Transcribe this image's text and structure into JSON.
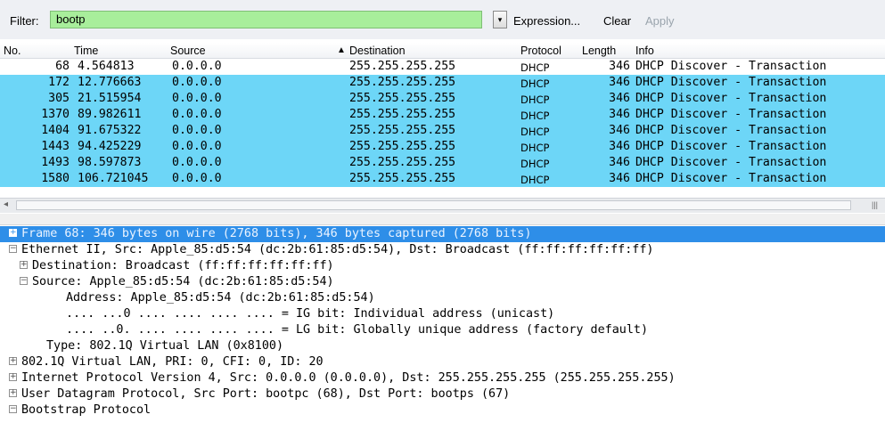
{
  "filter": {
    "label": "Filter:",
    "value": "bootp",
    "dropdown_icon": "▾",
    "expression_label": "Expression...",
    "clear_label": "Clear",
    "apply_label": "Apply"
  },
  "packet_list": {
    "columns": {
      "no": "No.",
      "time": "Time",
      "source": "Source",
      "sort_icon": "▲",
      "destination": "Destination",
      "protocol": "Protocol",
      "length": "Length",
      "info": "Info"
    },
    "rows": [
      {
        "no": "68",
        "time": "4.564813",
        "source": "0.0.0.0",
        "destination": "255.255.255.255",
        "protocol": "DHCP",
        "length": "346",
        "info": "DHCP Discover - Transaction"
      },
      {
        "no": "172",
        "time": "12.776663",
        "source": "0.0.0.0",
        "destination": "255.255.255.255",
        "protocol": "DHCP",
        "length": "346",
        "info": "DHCP Discover - Transaction"
      },
      {
        "no": "305",
        "time": "21.515954",
        "source": "0.0.0.0",
        "destination": "255.255.255.255",
        "protocol": "DHCP",
        "length": "346",
        "info": "DHCP Discover - Transaction"
      },
      {
        "no": "1370",
        "time": "89.982611",
        "source": "0.0.0.0",
        "destination": "255.255.255.255",
        "protocol": "DHCP",
        "length": "346",
        "info": "DHCP Discover - Transaction"
      },
      {
        "no": "1404",
        "time": "91.675322",
        "source": "0.0.0.0",
        "destination": "255.255.255.255",
        "protocol": "DHCP",
        "length": "346",
        "info": "DHCP Discover - Transaction"
      },
      {
        "no": "1443",
        "time": "94.425229",
        "source": "0.0.0.0",
        "destination": "255.255.255.255",
        "protocol": "DHCP",
        "length": "346",
        "info": "DHCP Discover - Transaction"
      },
      {
        "no": "1493",
        "time": "98.597873",
        "source": "0.0.0.0",
        "destination": "255.255.255.255",
        "protocol": "DHCP",
        "length": "346",
        "info": "DHCP Discover - Transaction"
      },
      {
        "no": "1580",
        "time": "106.721045",
        "source": "0.0.0.0",
        "destination": "255.255.255.255",
        "protocol": "DHCP",
        "length": "346",
        "info": "DHCP Discover - Transaction"
      }
    ],
    "scroll_left_icon": "◂",
    "scroll_grip_icon": "|||"
  },
  "details": {
    "rows": [
      {
        "expander": "+",
        "text": "Frame 68: 346 bytes on wire (2768 bits), 346 bytes captured (2768 bits)"
      },
      {
        "expander": "−",
        "text": "Ethernet II, Src: Apple_85:d5:54 (dc:2b:61:85:d5:54), Dst: Broadcast (ff:ff:ff:ff:ff:ff)"
      },
      {
        "expander": "+",
        "text": "Destination: Broadcast (ff:ff:ff:ff:ff:ff)"
      },
      {
        "expander": "−",
        "text": "Source: Apple_85:d5:54 (dc:2b:61:85:d5:54)"
      },
      {
        "expander": "",
        "text": "Address: Apple_85:d5:54 (dc:2b:61:85:d5:54)"
      },
      {
        "expander": "",
        "text": ".... ...0 .... .... .... .... = IG bit: Individual address (unicast)"
      },
      {
        "expander": "",
        "text": ".... ..0. .... .... .... .... = LG bit: Globally unique address (factory default)"
      },
      {
        "expander": "",
        "text": "Type: 802.1Q Virtual LAN (0x8100)"
      },
      {
        "expander": "+",
        "text": "802.1Q Virtual LAN, PRI: 0, CFI: 0, ID: 20"
      },
      {
        "expander": "+",
        "text": "Internet Protocol Version 4, Src: 0.0.0.0 (0.0.0.0), Dst: 255.255.255.255 (255.255.255.255)"
      },
      {
        "expander": "+",
        "text": "User Datagram Protocol, Src Port: bootpc (68), Dst Port: bootps (67)"
      },
      {
        "expander": "−",
        "text": "Bootstrap Protocol"
      }
    ]
  },
  "colors": {
    "filter_bg": "#a8ee9b",
    "row_selected": "#6dd6f7",
    "detail_selected": "#2e8ee8"
  }
}
